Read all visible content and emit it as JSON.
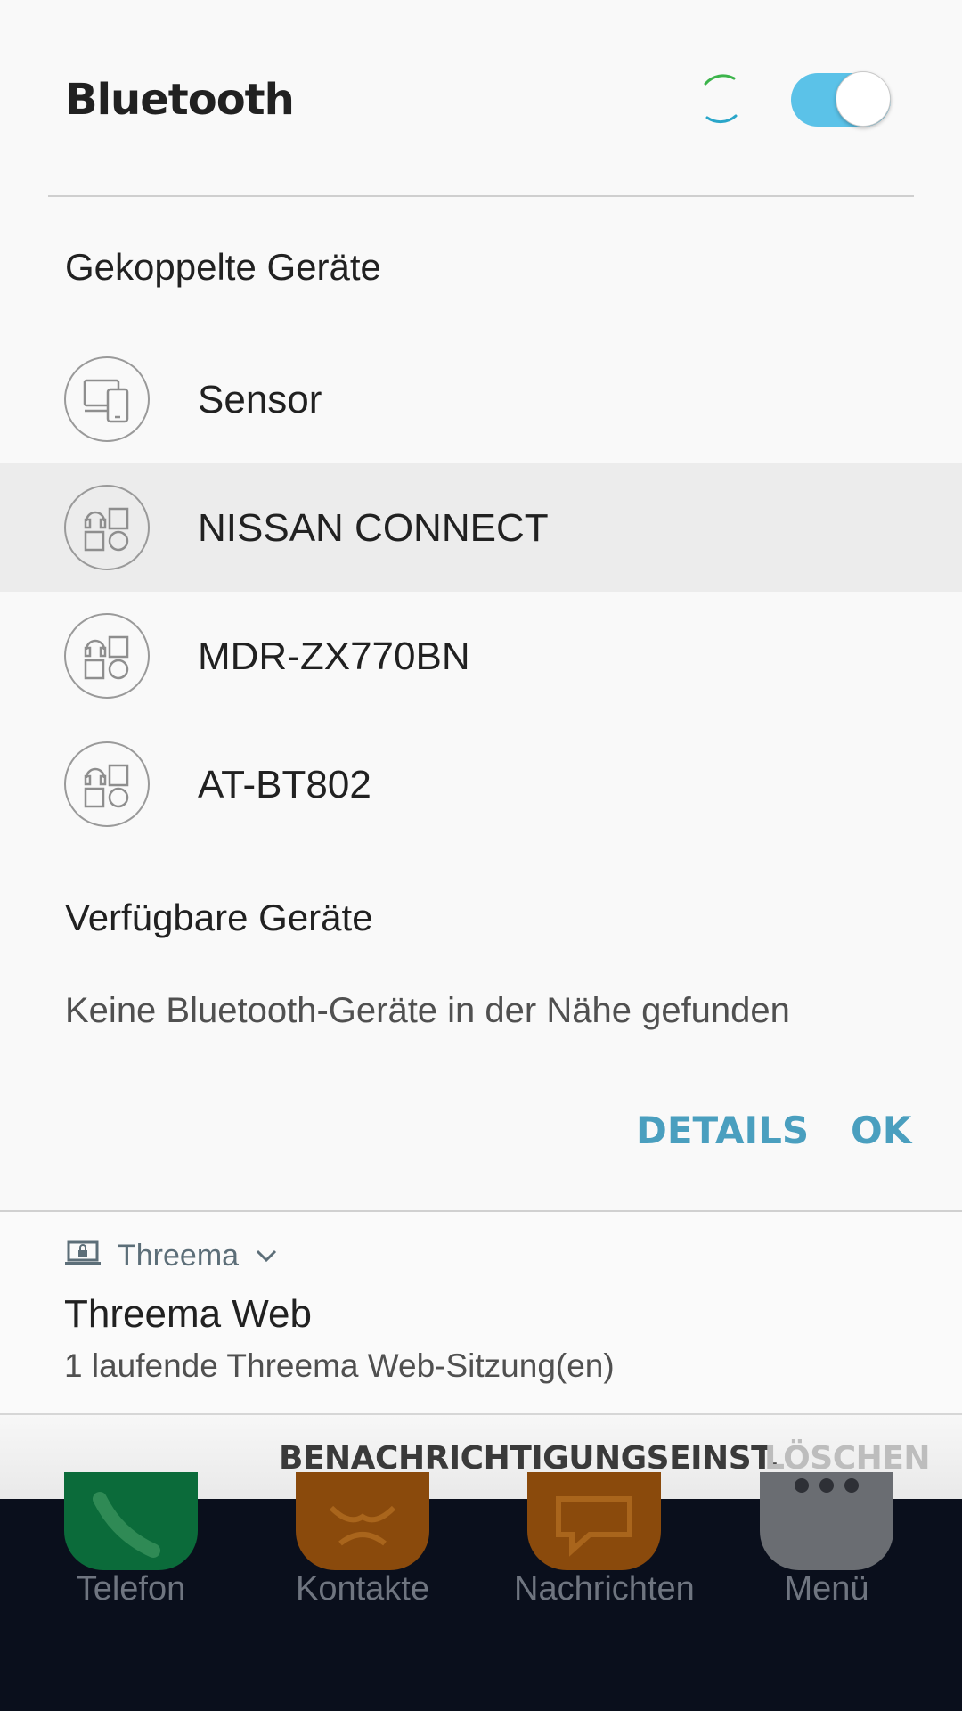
{
  "bluetooth": {
    "title": "Bluetooth",
    "enabled": true,
    "scanning": true,
    "paired_section_title": "Gekoppelte Geräte",
    "paired_devices": [
      {
        "name": "Sensor",
        "icon": "devices-icon",
        "highlighted": false
      },
      {
        "name": "NISSAN CONNECT",
        "icon": "multi-device-icon",
        "highlighted": true
      },
      {
        "name": "MDR-ZX770BN",
        "icon": "multi-device-icon",
        "highlighted": false
      },
      {
        "name": "AT-BT802",
        "icon": "multi-device-icon",
        "highlighted": false
      }
    ],
    "available_section_title": "Verfügbare Geräte",
    "available_empty_text": "Keine Bluetooth-Geräte in der Nähe gefunden",
    "buttons": {
      "details": "DETAILS",
      "ok": "OK"
    }
  },
  "notification": {
    "app_name": "Threema",
    "app_icon": "laptop-lock-icon",
    "title": "Threema Web",
    "text": "1 laufende Threema Web-Sitzung(en)",
    "actions": {
      "settings": "BENACHRICHTIGUNGSEINST.",
      "clear": "LÖSCHEN"
    }
  },
  "dock": {
    "items": [
      {
        "label": "Telefon",
        "icon": "phone-icon",
        "color": "#0b6b3a"
      },
      {
        "label": "Kontakte",
        "icon": "contacts-icon",
        "color": "#8a4a0c"
      },
      {
        "label": "Nachrichten",
        "icon": "messages-icon",
        "color": "#8a4a0c"
      },
      {
        "label": "Menü",
        "icon": "apps-menu-icon",
        "color": "#6a6d72"
      }
    ]
  },
  "colors": {
    "accent": "#4a9fbf",
    "toggle_on": "#5bc2e8",
    "highlight_row": "#ececec",
    "panel_bg": "#f9f9f9"
  }
}
